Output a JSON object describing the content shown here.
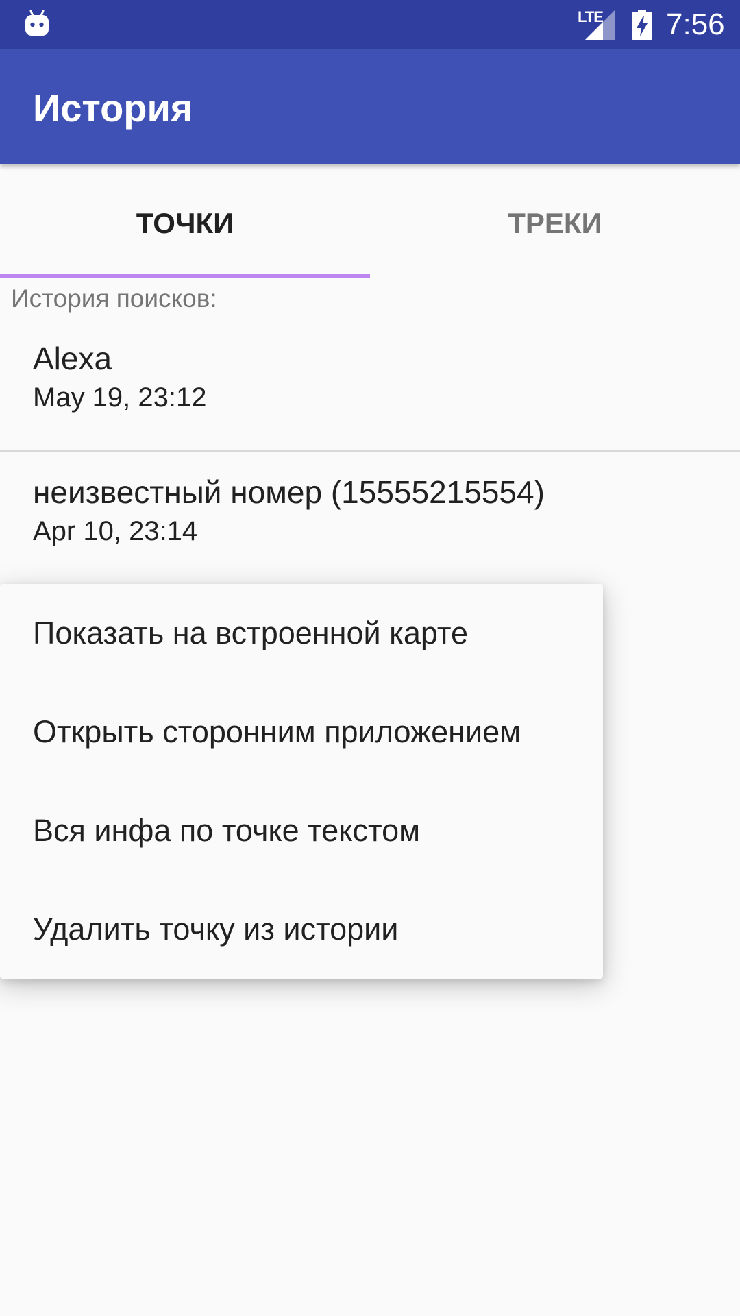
{
  "status_bar": {
    "network": "LTE",
    "time": "7:56",
    "icons": [
      "android-robot-icon",
      "lte-signal-icon",
      "battery-charging-icon"
    ]
  },
  "app_bar": {
    "title": "История",
    "color": "#3f51b5"
  },
  "tabs": [
    {
      "label": "ТОЧКИ",
      "selected": true
    },
    {
      "label": "ТРЕКИ",
      "selected": false
    }
  ],
  "history": {
    "label": "История поисков:",
    "items": [
      {
        "name": "Alexa",
        "date": "May 19, 23:12"
      },
      {
        "name": "неизвестный номер (15555215554)",
        "date": "Apr 10, 23:14"
      }
    ]
  },
  "context_menu": {
    "items": [
      {
        "label": "Показать на встроенной карте"
      },
      {
        "label": "Открыть сторонним приложением"
      },
      {
        "label": "Вся инфа по точке текстом"
      },
      {
        "label": "Удалить точку из истории"
      }
    ]
  },
  "colors": {
    "status_bar": "#303f9f",
    "app_bar": "#3f51b5",
    "tab_indicator": "#c086f0",
    "background": "#fafafa"
  }
}
